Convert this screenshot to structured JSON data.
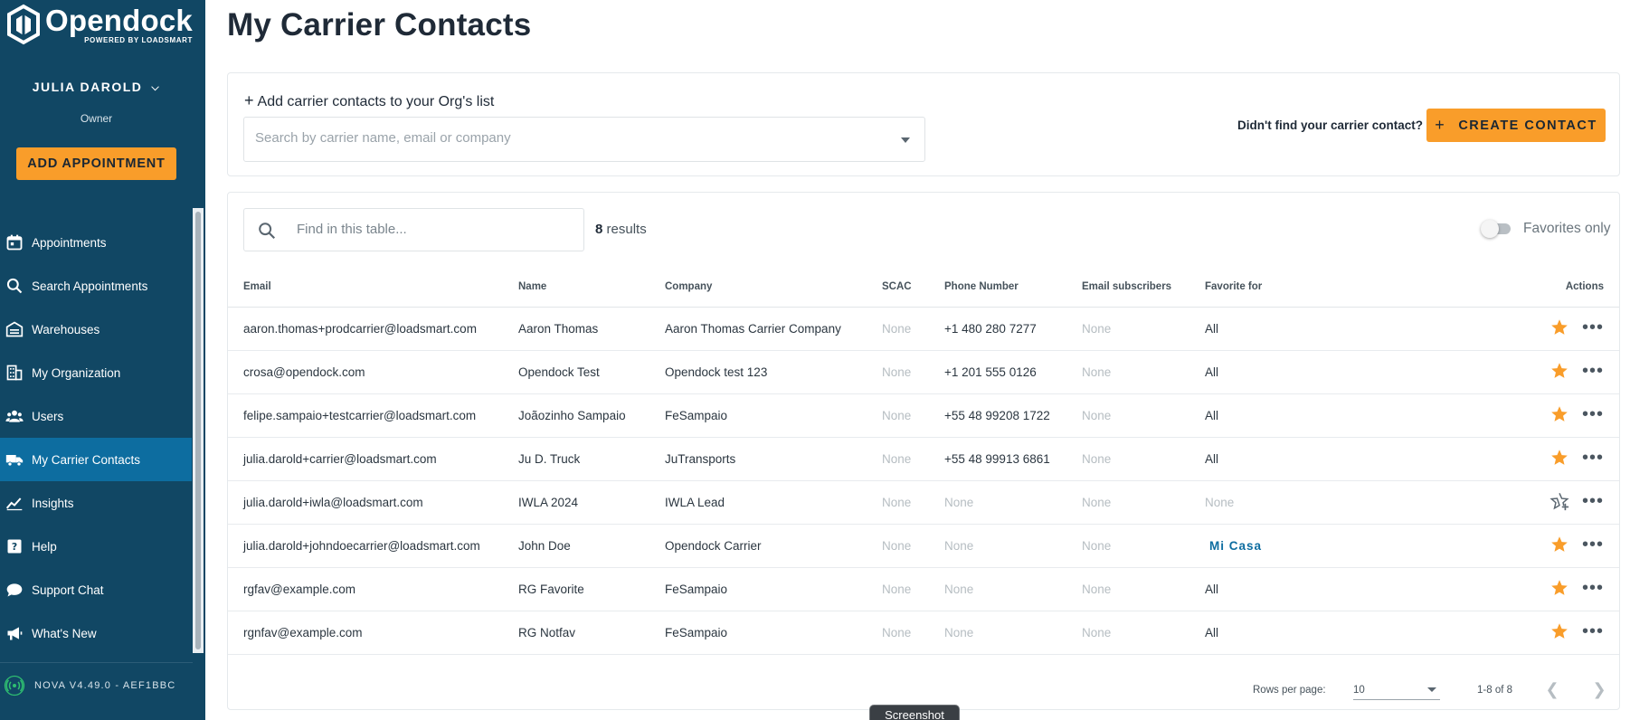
{
  "sidebar": {
    "logo_name": "Opendock",
    "logo_sub": "POWERED BY LOADSMART",
    "user_name": "JULIA DAROLD",
    "user_role": "Owner",
    "add_appointment_label": "ADD APPOINTMENT",
    "items": [
      {
        "label": "Appointments",
        "icon": "calendar-icon"
      },
      {
        "label": "Search Appointments",
        "icon": "search-icon"
      },
      {
        "label": "Warehouses",
        "icon": "warehouse-icon"
      },
      {
        "label": "My Organization",
        "icon": "building-icon"
      },
      {
        "label": "Users",
        "icon": "users-icon"
      },
      {
        "label": "My Carrier Contacts",
        "icon": "truck-icon",
        "active": true
      },
      {
        "label": "Insights",
        "icon": "chart-line-icon"
      },
      {
        "label": "Help",
        "icon": "help-icon"
      },
      {
        "label": "Support Chat",
        "icon": "chat-icon"
      },
      {
        "label": "What's New",
        "icon": "megaphone-icon"
      }
    ],
    "version": "NOVA V4.49.0 - AEF1BBC"
  },
  "page": {
    "title": "My Carrier Contacts"
  },
  "add_contacts": {
    "label": "Add carrier contacts to your Org's list",
    "search_placeholder": "Search by carrier name, email or company",
    "didnt_find": "Didn't find your carrier contact?",
    "create_label": "CREATE CONTACT"
  },
  "table_tools": {
    "find_placeholder": "Find in this table...",
    "results_count": "8",
    "results_label": "results",
    "favorites_only": "Favorites only",
    "favorites_only_on": false
  },
  "table": {
    "headers": {
      "email": "Email",
      "name": "Name",
      "company": "Company",
      "scac": "SCAC",
      "phone": "Phone Number",
      "subscribers": "Email subscribers",
      "favorite_for": "Favorite for",
      "actions": "Actions"
    },
    "rows": [
      {
        "email": "aaron.thomas+prodcarrier@loadsmart.com",
        "name": "Aaron Thomas",
        "company": "Aaron Thomas Carrier Company",
        "scac": "None",
        "phone": "+1 480 280 7277",
        "subscribers": "None",
        "favorite_for": "All",
        "favorite": true
      },
      {
        "email": "crosa@opendock.com",
        "name": "Opendock Test",
        "company": "Opendock test 123",
        "scac": "None",
        "phone": "+1 201 555 0126",
        "subscribers": "None",
        "favorite_for": "All",
        "favorite": true
      },
      {
        "email": "felipe.sampaio+testcarrier@loadsmart.com",
        "name": "Joãozinho Sampaio",
        "company": "FeSampaio",
        "scac": "None",
        "phone": "+55 48 99208 1722",
        "subscribers": "None",
        "favorite_for": "All",
        "favorite": true
      },
      {
        "email": "julia.darold+carrier@loadsmart.com",
        "name": "Ju D. Truck",
        "company": "JuTransports",
        "scac": "None",
        "phone": "+55 48 99913 6861",
        "subscribers": "None",
        "favorite_for": "All",
        "favorite": true
      },
      {
        "email": "julia.darold+iwla@loadsmart.com",
        "name": "IWLA 2024",
        "company": "IWLA Lead",
        "scac": "None",
        "phone": "None",
        "subscribers": "None",
        "favorite_for": "None",
        "favorite": false
      },
      {
        "email": "julia.darold+johndoecarrier@loadsmart.com",
        "name": "John Doe",
        "company": "Opendock Carrier",
        "scac": "None",
        "phone": "None",
        "subscribers": "None",
        "favorite_for": "Mi Casa",
        "favorite": true
      },
      {
        "email": "rgfav@example.com",
        "name": "RG Favorite",
        "company": "FeSampaio",
        "scac": "None",
        "phone": "None",
        "subscribers": "None",
        "favorite_for": "All",
        "favorite": true
      },
      {
        "email": "rgnfav@example.com",
        "name": "RG Notfav",
        "company": "FeSampaio",
        "scac": "None",
        "phone": "None",
        "subscribers": "None",
        "favorite_for": "All",
        "favorite": true
      }
    ]
  },
  "pagination": {
    "rows_per_page_label": "Rows per page:",
    "rows_per_page": "10",
    "range": "1-8 of 8"
  },
  "tooltip": "Screenshot",
  "colors": {
    "sidebar_bg": "#114764",
    "active_nav": "#0d6da0",
    "accent": "#f99d2a",
    "star": "#f99d2a"
  }
}
